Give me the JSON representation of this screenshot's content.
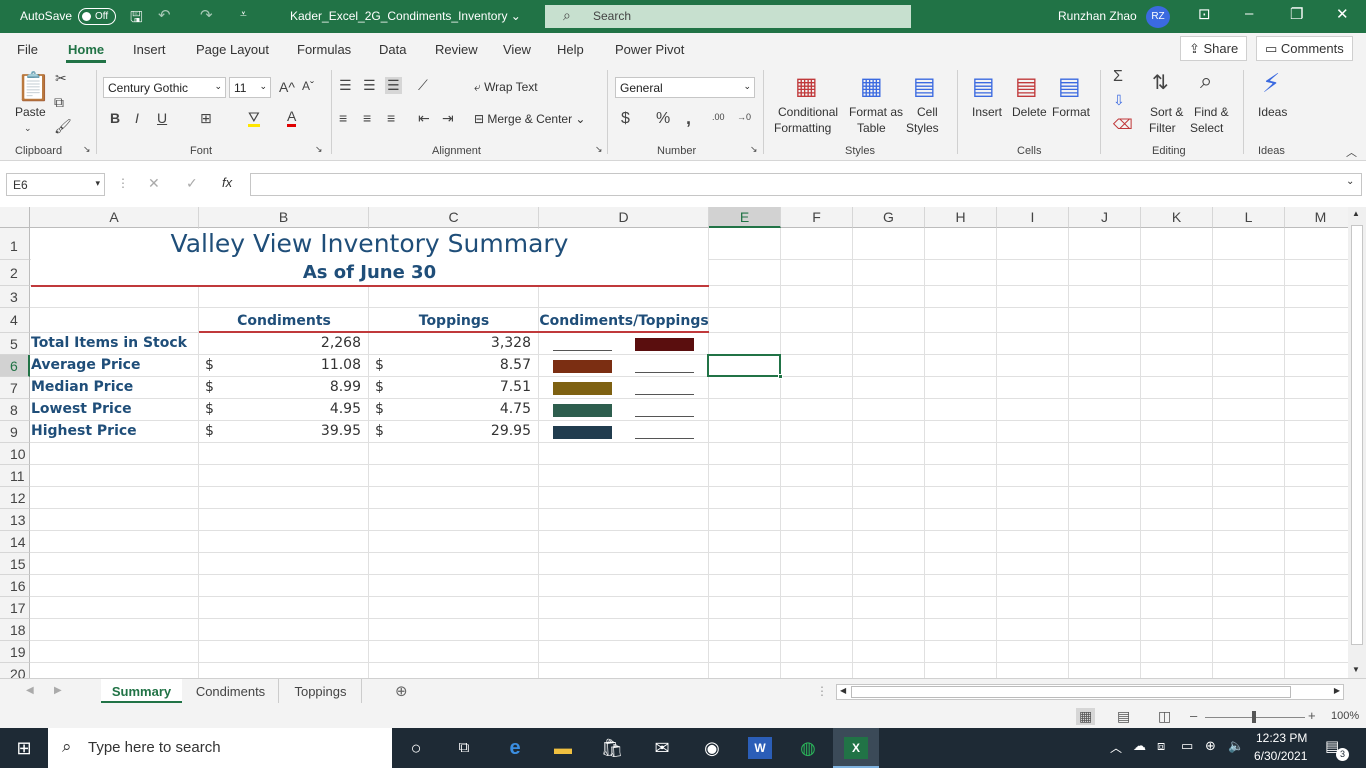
{
  "titlebar": {
    "autosave": "AutoSave",
    "autosave_state": "Off",
    "filename": "Kader_Excel_2G_Condiments_Inventory",
    "search": "Search",
    "user": "Runzhan Zhao",
    "initials": "RZ"
  },
  "menu": {
    "tabs": [
      "File",
      "Home",
      "Insert",
      "Page Layout",
      "Formulas",
      "Data",
      "Review",
      "View",
      "Help",
      "Power Pivot"
    ],
    "active": "Home",
    "share": "Share",
    "comments": "Comments"
  },
  "ribbon": {
    "clipboard": {
      "paste": "Paste",
      "group": "Clipboard"
    },
    "font": {
      "name": "Century Gothic",
      "size": "11",
      "bold": "B",
      "italic": "I",
      "underline": "U",
      "group": "Font"
    },
    "alignment": {
      "wrap": "Wrap Text",
      "merge": "Merge & Center",
      "group": "Alignment"
    },
    "number": {
      "format": "General",
      "currency": "$",
      "percent": "%",
      "comma": ",",
      "inc": ".00",
      "dec": "→0",
      "group": "Number"
    },
    "styles": {
      "cond1": "Conditional",
      "cond2": "Formatting",
      "fmt1": "Format as",
      "fmt2": "Table",
      "cell1": "Cell",
      "cell2": "Styles",
      "group": "Styles"
    },
    "cells": {
      "insert": "Insert",
      "delete": "Delete",
      "format": "Format",
      "group": "Cells"
    },
    "editing": {
      "sort1": "Sort &",
      "sort2": "Filter",
      "find1": "Find &",
      "find2": "Select",
      "group": "Editing"
    },
    "ideas": {
      "label": "Ideas",
      "group": "Ideas"
    }
  },
  "formula": {
    "namebox": "E6",
    "fx": "fx",
    "value": ""
  },
  "columns": [
    "A",
    "B",
    "C",
    "D",
    "E",
    "F",
    "G",
    "H",
    "I",
    "J",
    "K",
    "L",
    "M"
  ],
  "rows": [
    "1",
    "2",
    "3",
    "4",
    "5",
    "6",
    "7",
    "8",
    "9",
    "10",
    "11",
    "12",
    "13",
    "14",
    "15",
    "16",
    "17",
    "18",
    "19",
    "20"
  ],
  "sheet": {
    "title": "Valley View Inventory Summary",
    "subtitle": "As of June 30",
    "headers": {
      "b": "Condiments",
      "c": "Toppings",
      "d": "Condiments/Toppings"
    },
    "rows": [
      {
        "label": "Total Items in Stock",
        "b_dollar": "",
        "b": "2,268",
        "c_dollar": "",
        "c": "3,328",
        "sw1": "",
        "sw2": "#5a0e0e"
      },
      {
        "label": "Average Price",
        "b_dollar": "$",
        "b": "11.08",
        "c_dollar": "$",
        "c": "8.57",
        "sw1": "#7b2e12",
        "sw2": ""
      },
      {
        "label": "Median Price",
        "b_dollar": "$",
        "b": "8.99",
        "c_dollar": "$",
        "c": "7.51",
        "sw1": "#7e6112",
        "sw2": ""
      },
      {
        "label": "Lowest Price",
        "b_dollar": "$",
        "b": "4.95",
        "c_dollar": "$",
        "c": "4.75",
        "sw1": "#2e5e4e",
        "sw2": ""
      },
      {
        "label": "Highest Price",
        "b_dollar": "$",
        "b": "39.95",
        "c_dollar": "$",
        "c": "29.95",
        "sw1": "#213c4e",
        "sw2": ""
      }
    ]
  },
  "sheettabs": {
    "tabs": [
      "Summary",
      "Condiments",
      "Toppings"
    ],
    "active": "Summary"
  },
  "status": {
    "zoom": "100%"
  },
  "taskbar": {
    "search": "Type here to search",
    "time": "12:23 PM",
    "date": "6/30/2021",
    "notif": "3"
  },
  "colors": {
    "excel_green": "#217346",
    "title_red": "#c0393b",
    "label_blue": "#1f4e79"
  }
}
